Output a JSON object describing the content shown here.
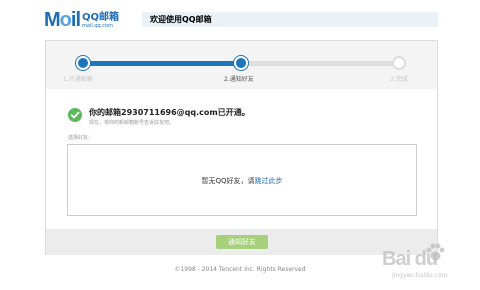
{
  "logo": {
    "mail": "M",
    "mail_o": "o",
    "mail_il": "il",
    "qq": "QQ邮箱",
    "url": "mail.qq.com"
  },
  "header": {
    "title": "欢迎使用QQ邮箱"
  },
  "steps": [
    {
      "label": "1.开通邮箱",
      "state": "done"
    },
    {
      "label": "2.通知好友",
      "state": "active"
    },
    {
      "label": "3.完成",
      "state": "todo"
    }
  ],
  "activation": {
    "message": "你的邮箱2930711696@qq.com已开通。",
    "tip": "现在，将你的新邮箱帐号告诉好友吧。"
  },
  "friends": {
    "label": "选择好友：",
    "empty_text": "暂无QQ好友，请",
    "skip_link": "跳过此步"
  },
  "actions": {
    "notify_button": "通知好友"
  },
  "footer": {
    "copyright": "©1998 - 2014 Tencent Inc. Rights Reserved"
  },
  "watermark": {
    "text": "Bai du",
    "sub": "jingyan.baidu.com"
  },
  "colors": {
    "accent": "#1d75bb",
    "success": "#5cb85c",
    "button": "#a7d07c",
    "link": "#1c6db6"
  }
}
